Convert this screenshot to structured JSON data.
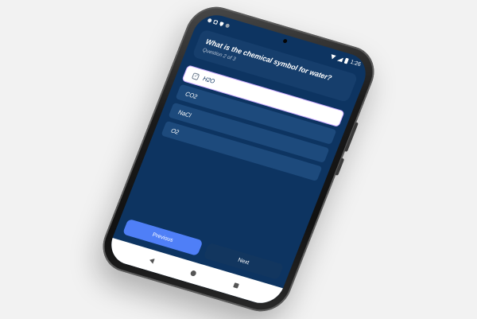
{
  "status_bar": {
    "time": "1:26"
  },
  "question": {
    "title": "What is the chemical symbol for water?",
    "progress": "Question 2 of 3"
  },
  "options": [
    {
      "label": "H2O",
      "selected": true
    },
    {
      "label": "CO2",
      "selected": false
    },
    {
      "label": "NaCl",
      "selected": false
    },
    {
      "label": "O2",
      "selected": false
    }
  ],
  "nav": {
    "previous_label": "Previous",
    "next_label": "Next"
  },
  "icons": {
    "selected_option": "check-icon",
    "system_back": "back-icon",
    "system_home": "home-icon",
    "system_recents": "recents-icon"
  },
  "colors": {
    "screen_background": "#0d3461",
    "option_background": "#1d4a7c",
    "selected_option_background": "#ffffff",
    "previous_button": "#4f7ff7",
    "next_button": "#12365f"
  }
}
